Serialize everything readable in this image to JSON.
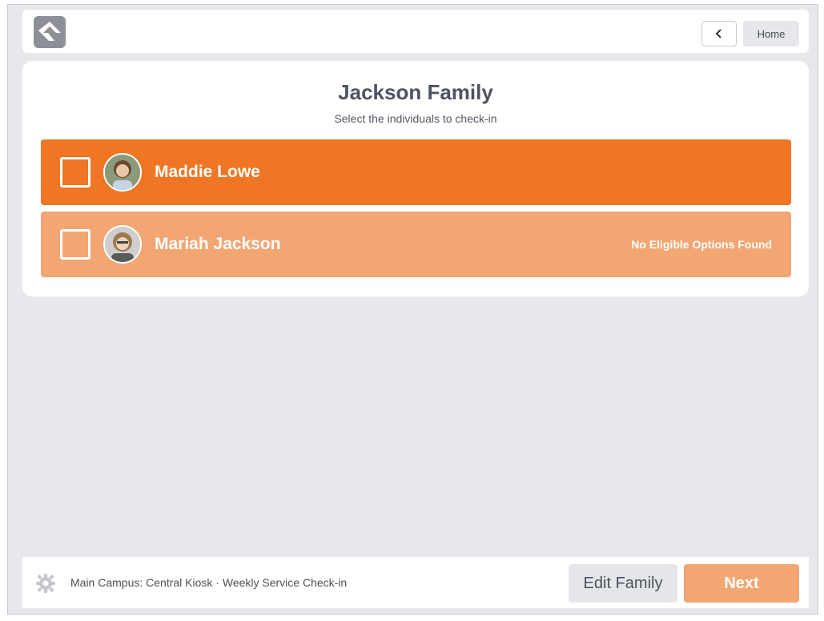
{
  "header": {
    "logo_icon": "rock-logo-icon",
    "back_icon": "chevron-left-icon",
    "home_label": "Home"
  },
  "family": {
    "title": "Jackson Family",
    "subtitle": "Select the individuals to check-in"
  },
  "people": [
    {
      "name": "Maddie Lowe",
      "note": "",
      "selected": false,
      "color": "#ee7625"
    },
    {
      "name": "Mariah Jackson",
      "note": "No Eligible Options Found",
      "selected": false,
      "color": "#f2a672"
    }
  ],
  "footer": {
    "settings_icon": "gear-icon",
    "kiosk_info": "Main Campus: Central Kiosk · Weekly Service Check-in",
    "edit_label": "Edit Family",
    "next_label": "Next"
  },
  "colors": {
    "accent": "#ee7625",
    "accent_disabled": "#f2a672",
    "background": "#e7e8ec"
  }
}
